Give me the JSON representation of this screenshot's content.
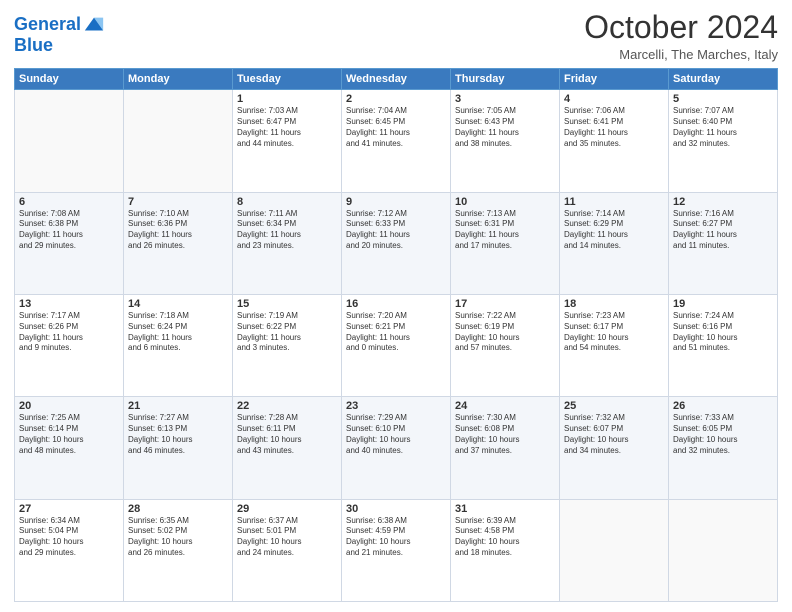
{
  "header": {
    "logo_line1": "General",
    "logo_line2": "Blue",
    "month_title": "October 2024",
    "location": "Marcelli, The Marches, Italy"
  },
  "days_of_week": [
    "Sunday",
    "Monday",
    "Tuesday",
    "Wednesday",
    "Thursday",
    "Friday",
    "Saturday"
  ],
  "weeks": [
    [
      {
        "day": "",
        "content": ""
      },
      {
        "day": "",
        "content": ""
      },
      {
        "day": "1",
        "content": "Sunrise: 7:03 AM\nSunset: 6:47 PM\nDaylight: 11 hours\nand 44 minutes."
      },
      {
        "day": "2",
        "content": "Sunrise: 7:04 AM\nSunset: 6:45 PM\nDaylight: 11 hours\nand 41 minutes."
      },
      {
        "day": "3",
        "content": "Sunrise: 7:05 AM\nSunset: 6:43 PM\nDaylight: 11 hours\nand 38 minutes."
      },
      {
        "day": "4",
        "content": "Sunrise: 7:06 AM\nSunset: 6:41 PM\nDaylight: 11 hours\nand 35 minutes."
      },
      {
        "day": "5",
        "content": "Sunrise: 7:07 AM\nSunset: 6:40 PM\nDaylight: 11 hours\nand 32 minutes."
      }
    ],
    [
      {
        "day": "6",
        "content": "Sunrise: 7:08 AM\nSunset: 6:38 PM\nDaylight: 11 hours\nand 29 minutes."
      },
      {
        "day": "7",
        "content": "Sunrise: 7:10 AM\nSunset: 6:36 PM\nDaylight: 11 hours\nand 26 minutes."
      },
      {
        "day": "8",
        "content": "Sunrise: 7:11 AM\nSunset: 6:34 PM\nDaylight: 11 hours\nand 23 minutes."
      },
      {
        "day": "9",
        "content": "Sunrise: 7:12 AM\nSunset: 6:33 PM\nDaylight: 11 hours\nand 20 minutes."
      },
      {
        "day": "10",
        "content": "Sunrise: 7:13 AM\nSunset: 6:31 PM\nDaylight: 11 hours\nand 17 minutes."
      },
      {
        "day": "11",
        "content": "Sunrise: 7:14 AM\nSunset: 6:29 PM\nDaylight: 11 hours\nand 14 minutes."
      },
      {
        "day": "12",
        "content": "Sunrise: 7:16 AM\nSunset: 6:27 PM\nDaylight: 11 hours\nand 11 minutes."
      }
    ],
    [
      {
        "day": "13",
        "content": "Sunrise: 7:17 AM\nSunset: 6:26 PM\nDaylight: 11 hours\nand 9 minutes."
      },
      {
        "day": "14",
        "content": "Sunrise: 7:18 AM\nSunset: 6:24 PM\nDaylight: 11 hours\nand 6 minutes."
      },
      {
        "day": "15",
        "content": "Sunrise: 7:19 AM\nSunset: 6:22 PM\nDaylight: 11 hours\nand 3 minutes."
      },
      {
        "day": "16",
        "content": "Sunrise: 7:20 AM\nSunset: 6:21 PM\nDaylight: 11 hours\nand 0 minutes."
      },
      {
        "day": "17",
        "content": "Sunrise: 7:22 AM\nSunset: 6:19 PM\nDaylight: 10 hours\nand 57 minutes."
      },
      {
        "day": "18",
        "content": "Sunrise: 7:23 AM\nSunset: 6:17 PM\nDaylight: 10 hours\nand 54 minutes."
      },
      {
        "day": "19",
        "content": "Sunrise: 7:24 AM\nSunset: 6:16 PM\nDaylight: 10 hours\nand 51 minutes."
      }
    ],
    [
      {
        "day": "20",
        "content": "Sunrise: 7:25 AM\nSunset: 6:14 PM\nDaylight: 10 hours\nand 48 minutes."
      },
      {
        "day": "21",
        "content": "Sunrise: 7:27 AM\nSunset: 6:13 PM\nDaylight: 10 hours\nand 46 minutes."
      },
      {
        "day": "22",
        "content": "Sunrise: 7:28 AM\nSunset: 6:11 PM\nDaylight: 10 hours\nand 43 minutes."
      },
      {
        "day": "23",
        "content": "Sunrise: 7:29 AM\nSunset: 6:10 PM\nDaylight: 10 hours\nand 40 minutes."
      },
      {
        "day": "24",
        "content": "Sunrise: 7:30 AM\nSunset: 6:08 PM\nDaylight: 10 hours\nand 37 minutes."
      },
      {
        "day": "25",
        "content": "Sunrise: 7:32 AM\nSunset: 6:07 PM\nDaylight: 10 hours\nand 34 minutes."
      },
      {
        "day": "26",
        "content": "Sunrise: 7:33 AM\nSunset: 6:05 PM\nDaylight: 10 hours\nand 32 minutes."
      }
    ],
    [
      {
        "day": "27",
        "content": "Sunrise: 6:34 AM\nSunset: 5:04 PM\nDaylight: 10 hours\nand 29 minutes."
      },
      {
        "day": "28",
        "content": "Sunrise: 6:35 AM\nSunset: 5:02 PM\nDaylight: 10 hours\nand 26 minutes."
      },
      {
        "day": "29",
        "content": "Sunrise: 6:37 AM\nSunset: 5:01 PM\nDaylight: 10 hours\nand 24 minutes."
      },
      {
        "day": "30",
        "content": "Sunrise: 6:38 AM\nSunset: 4:59 PM\nDaylight: 10 hours\nand 21 minutes."
      },
      {
        "day": "31",
        "content": "Sunrise: 6:39 AM\nSunset: 4:58 PM\nDaylight: 10 hours\nand 18 minutes."
      },
      {
        "day": "",
        "content": ""
      },
      {
        "day": "",
        "content": ""
      }
    ]
  ]
}
